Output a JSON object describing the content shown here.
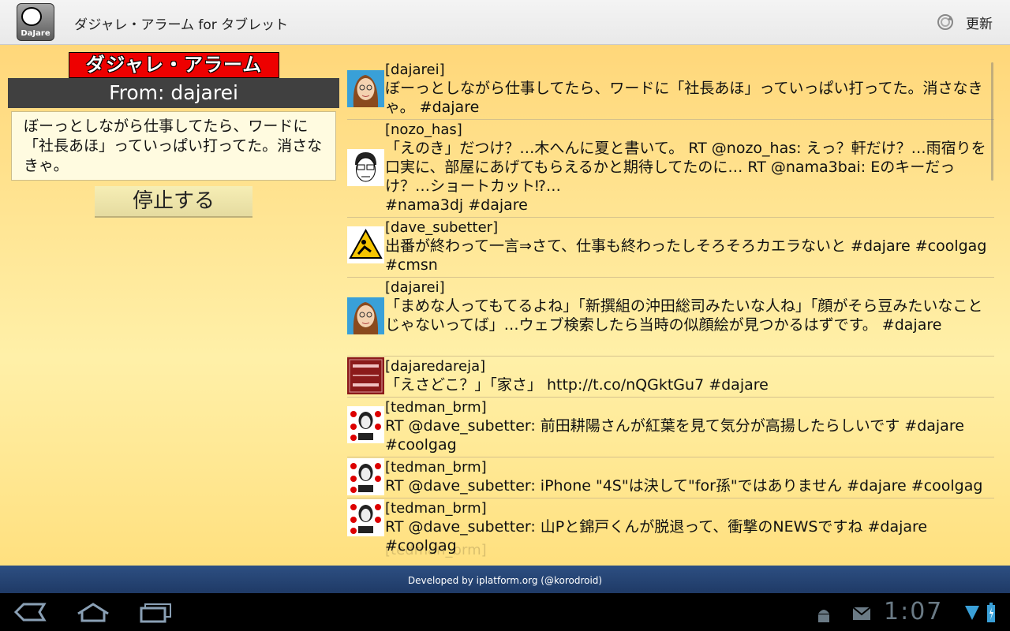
{
  "app": {
    "title": "ダジャレ・アラーム for タブレット",
    "icon_label": "DaJare",
    "refresh_label": "更新"
  },
  "alarm": {
    "banner": "ダジャレ・アラーム",
    "from": "From: dajarei",
    "message": "ぼーっとしながら仕事してたら、ワードに「社長あほ」っていっぱい打ってた。消さなきゃ。",
    "stop_button": "停止する"
  },
  "timeline": [
    {
      "user": "[dajarei]",
      "text": "ぼーっとしながら仕事してたら、ワードに「社長あほ」っていっぱい打ってた。消さなきゃ。 #dajare",
      "avatar": "woman-avatar"
    },
    {
      "user": "[nozo_has]",
      "text": "「えのき」だつけ？…木へんに夏と書いて。 RT @nozo_has: えっ？軒だけ？…雨宿りを口実に、部屋にあげてもらえるかと期待してたのに… RT @nama3bai: Eのキーだっけ？…ショートカット⁉…\n #nama3dj #dajare",
      "avatar": "glasses-man-avatar"
    },
    {
      "user": "[dave_subetter]",
      "text": "出番が終わって一言⇒さて、仕事も終わったしそろそろカエラないと #dajare #coolgag #cmsn",
      "avatar": "caution-sign-avatar"
    },
    {
      "user": "[dajarei]",
      "text": "「まめな人ってもてるよね」「新撰組の沖田総司みたいな人ね」「顔がそら豆みたいなことじゃないってば」…ウェブ検索したら当時の似顔絵が見つかるはずです。 #dajare",
      "avatar": "woman-avatar"
    },
    {
      "user": "[dajaredareja]",
      "text": "「えさどこ？」「家さ」 http://t.co/nQGktGu7 #dajare",
      "avatar": "dajare-logo-avatar"
    },
    {
      "user": "[tedman_brm]",
      "text": "RT @dave_subetter: 前田耕陽さんが紅葉を見て気分が高揚したらしいです #dajare #coolgag",
      "avatar": "poster-avatar"
    },
    {
      "user": "[tedman_brm]",
      "text": "RT @dave_subetter: iPhone \"4S\"は決して\"for孫\"ではありません #dajare #coolgag",
      "avatar": "poster-avatar"
    },
    {
      "user": "[tedman_brm]",
      "text": "RT @dave_subetter: 山Pと錦戸くんが脱退って、衝撃のNEWSですね #dajare #coolgag",
      "avatar": "poster-avatar"
    }
  ],
  "timeline_next_user": "[tedman_brm]",
  "footer": "Developed by iplatform.org (@korodroid)",
  "status": {
    "time": "1:07"
  }
}
